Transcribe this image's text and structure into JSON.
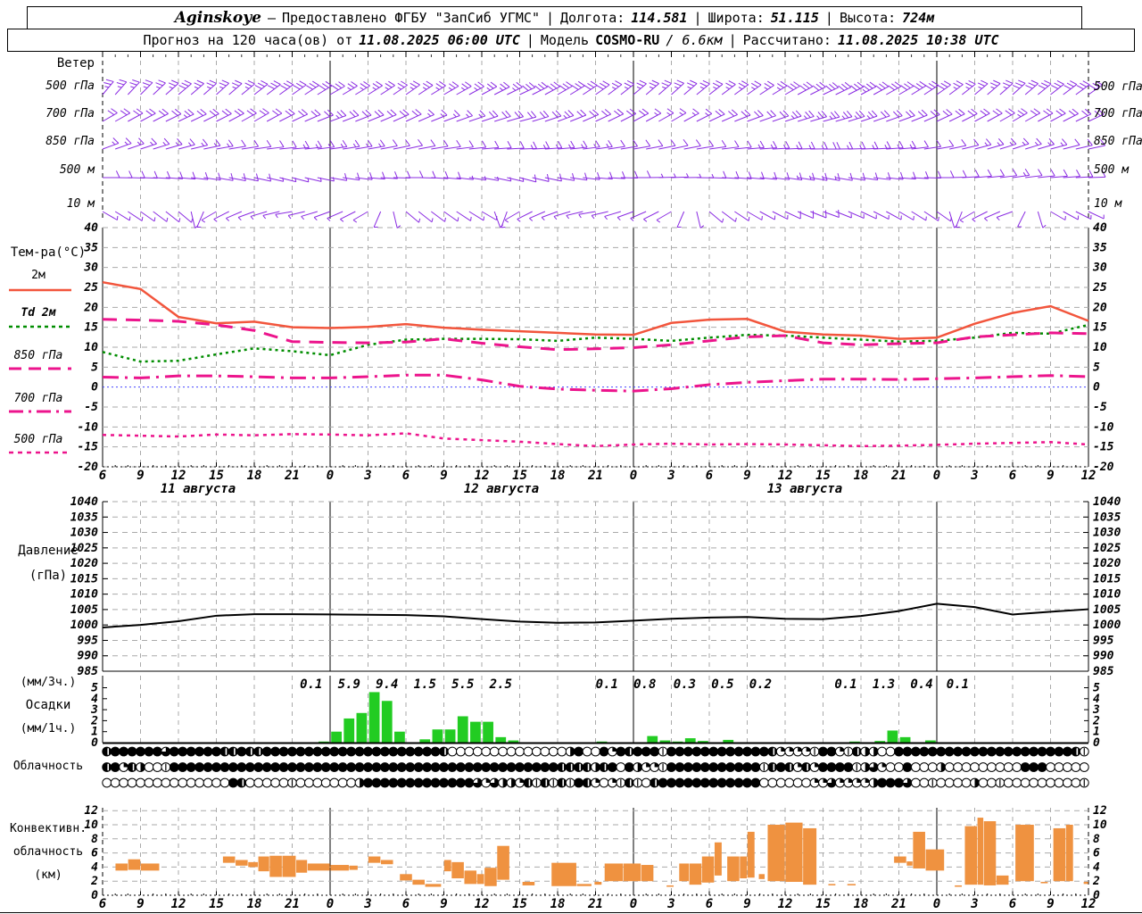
{
  "title_row1": {
    "station": "Aginskoye",
    "dash": "—",
    "provider": "Предоставлено ФГБУ \"ЗапСиб УГМС\"",
    "sep": "|",
    "lon_label": "Долгота:",
    "lon": "114.581",
    "lat_label": "Широта:",
    "lat": "51.115",
    "alt_label": "Высота:",
    "alt": "724м"
  },
  "title_row2": {
    "pre": "Прогноз на 120 часа(ов) от",
    "run": "11.08.2025 06:00 UTC",
    "sep": "|",
    "model_label": "Модель",
    "model_name": "COSMO-RU",
    "model_res": "/ 6.6км",
    "calc_label": "Рассчитано:",
    "calc": "11.08.2025 10:38 UTC"
  },
  "panel_labels": {
    "wind": "Ветер",
    "temp": "Тем-ра(°C)",
    "pressure1": "Давление",
    "pressure2": "(гПа)",
    "precip1": "(мм/3ч.)",
    "precip2": "Осадки",
    "precip3": "(мм/1ч.)",
    "cloud": "Облачность",
    "conv1": "Конвективн.",
    "conv2": "облачность",
    "conv3": "(км)"
  },
  "wind_levels": [
    "500 гПа",
    "700 гПа",
    "850 гПа",
    "500 м",
    "10 м"
  ],
  "temp_legend": [
    {
      "label": "2м",
      "color": "#f2553c",
      "dash": "",
      "width": 2.5
    },
    {
      "label": "Td  2м",
      "color": "#008d00",
      "dash": "4,4",
      "width": 2.5
    },
    {
      "label": "850 гПа",
      "color": "#ec148c",
      "dash": "14,8",
      "width": 3
    },
    {
      "label": "700 гПа",
      "color": "#ec148c",
      "dash": "16,6,3,6",
      "width": 3
    },
    {
      "label": "500 гПа",
      "color": "#ec148c",
      "dash": "5,5",
      "width": 2.5
    }
  ],
  "time_axis": {
    "labels": [
      "6",
      "9",
      "12",
      "15",
      "18",
      "21",
      "0",
      "3",
      "6",
      "9",
      "12",
      "15",
      "18",
      "21",
      "0",
      "3",
      "6",
      "9",
      "12",
      "15",
      "18",
      "21",
      "0",
      "3",
      "6",
      "9",
      "12"
    ],
    "dates": [
      {
        "label": "11 августа",
        "tick": 2
      },
      {
        "label": "12 августа",
        "tick": 10
      },
      {
        "label": "13 августа",
        "tick": 18
      }
    ]
  },
  "colors": {
    "red": "#f2553c",
    "green": "#008d00",
    "magenta": "#ec148c",
    "purple": "#8a2be2",
    "orange": "#ef9240",
    "precip_green": "#22cc22",
    "grid": "#aaaaaa",
    "zero_blue": "#4444ff",
    "black": "#000000"
  },
  "chart_data": [
    {
      "type": "line",
      "name": "temperature",
      "title": "Тем-ра(°C)",
      "x_start_hour": 0,
      "x_step_hours": 3,
      "x_end_hour": 78,
      "ylim": [
        -20,
        40
      ],
      "ytick_step": 5,
      "grid": true,
      "series": [
        {
          "name": "2м",
          "color": "#f2553c",
          "dash": "",
          "width": 2.5,
          "values": [
            26.3,
            24.6,
            17.6,
            16.0,
            16.4,
            15.0,
            14.8,
            15.1,
            15.8,
            14.9,
            14.4,
            14.0,
            13.6,
            13.2,
            13.1,
            16.1,
            16.9,
            17.1,
            13.9,
            13.2,
            12.9,
            12.1,
            12.4,
            15.9,
            18.6,
            20.3,
            16.6
          ]
        },
        {
          "name": "Td 2м",
          "color": "#008d00",
          "dash": "3,4",
          "width": 2.5,
          "values": [
            8.8,
            6.4,
            6.6,
            8.2,
            9.7,
            9.0,
            8.0,
            10.6,
            11.9,
            12.1,
            12.1,
            12.0,
            11.6,
            12.4,
            12.1,
            11.6,
            12.4,
            13.1,
            12.9,
            12.4,
            11.9,
            11.4,
            11.6,
            12.4,
            13.6,
            13.4,
            15.6
          ]
        },
        {
          "name": "850 гПа",
          "color": "#ec148c",
          "dash": "16,10",
          "width": 3,
          "values": [
            17.0,
            16.8,
            16.5,
            15.6,
            14.2,
            11.4,
            11.2,
            11.1,
            11.3,
            12.1,
            11.0,
            10.1,
            9.4,
            9.6,
            9.9,
            10.6,
            11.6,
            12.6,
            12.9,
            11.1,
            10.6,
            10.9,
            11.1,
            12.6,
            13.1,
            13.6,
            13.4
          ]
        },
        {
          "name": "700 гПа",
          "color": "#ec148c",
          "dash": "18,7,3,7",
          "width": 3,
          "values": [
            2.5,
            2.3,
            2.8,
            2.8,
            2.6,
            2.3,
            2.3,
            2.6,
            3.0,
            3.0,
            1.8,
            0.2,
            -0.5,
            -0.8,
            -1.0,
            -0.4,
            0.6,
            1.2,
            1.6,
            2.0,
            2.0,
            1.9,
            2.1,
            2.3,
            2.6,
            2.9,
            2.6
          ]
        },
        {
          "name": "500 гПа",
          "color": "#ec148c",
          "dash": "4,5",
          "width": 2.5,
          "values": [
            -12.0,
            -12.2,
            -12.4,
            -11.9,
            -12.1,
            -11.8,
            -11.9,
            -12.1,
            -11.6,
            -12.9,
            -13.3,
            -13.7,
            -14.3,
            -14.8,
            -14.4,
            -14.2,
            -14.4,
            -14.3,
            -14.4,
            -14.6,
            -14.8,
            -14.7,
            -14.5,
            -14.2,
            -14.0,
            -13.8,
            -14.4
          ]
        }
      ],
      "zero_line_value": 0
    },
    {
      "type": "line",
      "name": "pressure",
      "title": "Давление (гПа)",
      "ylim": [
        985,
        1040
      ],
      "ytick_step": 5,
      "color": "#000000",
      "values": [
        999.2,
        1000.0,
        1001.2,
        1003.0,
        1003.5,
        1003.5,
        1003.4,
        1003.3,
        1003.2,
        1002.8,
        1001.9,
        1001.1,
        1000.7,
        1000.8,
        1001.4,
        1002.0,
        1002.4,
        1002.6,
        1002.0,
        1001.9,
        1002.9,
        1004.5,
        1006.9,
        1005.8,
        1003.4,
        1004.3,
        1005.1
      ]
    },
    {
      "type": "bar",
      "name": "precipitation",
      "title": "Осадки (мм/1ч.)",
      "ylim": [
        0,
        6
      ],
      "yticks": [
        0,
        1,
        2,
        3,
        4,
        5
      ],
      "color": "#22cc22",
      "bars_hourly": [
        [
          17,
          0.1
        ],
        [
          18,
          1.0
        ],
        [
          19,
          2.2
        ],
        [
          20,
          2.7
        ],
        [
          21,
          4.6
        ],
        [
          22,
          3.8
        ],
        [
          23,
          1.0
        ],
        [
          25,
          0.3
        ],
        [
          26,
          1.2
        ],
        [
          27,
          1.2
        ],
        [
          28,
          2.4
        ],
        [
          29,
          1.9
        ],
        [
          30,
          1.9
        ],
        [
          31,
          0.5
        ],
        [
          32,
          0.2
        ],
        [
          39,
          0.1
        ],
        [
          43,
          0.6
        ],
        [
          44,
          0.2
        ],
        [
          45,
          0.1
        ],
        [
          46,
          0.4
        ],
        [
          47,
          0.15
        ],
        [
          49,
          0.25
        ],
        [
          59,
          0.1
        ],
        [
          61,
          0.15
        ],
        [
          62,
          1.1
        ],
        [
          63,
          0.5
        ],
        [
          65,
          0.2
        ]
      ],
      "sum_labels_3h": [
        [
          5.5,
          "0.1"
        ],
        [
          6.5,
          "5.9"
        ],
        [
          7.5,
          "9.4"
        ],
        [
          8.5,
          "1.5"
        ],
        [
          9.5,
          "5.5"
        ],
        [
          10.5,
          "2.5"
        ],
        [
          13.3,
          "0.1"
        ],
        [
          14.3,
          "0.8"
        ],
        [
          15.35,
          "0.3"
        ],
        [
          16.35,
          "0.5"
        ],
        [
          17.35,
          "0.2"
        ],
        [
          19.6,
          "0.1"
        ],
        [
          20.6,
          "1.3"
        ],
        [
          21.6,
          "0.4"
        ],
        [
          22.55,
          "0.1"
        ]
      ]
    },
    {
      "type": "range-bar",
      "name": "convective-cloud",
      "title": "Конвективная облачность (км)",
      "ylim": [
        0,
        13
      ],
      "yticks": [
        0,
        2,
        4,
        6,
        8,
        10,
        12
      ],
      "color": "#ef9240",
      "bars": [
        [
          1,
          2,
          3.5,
          4.5
        ],
        [
          2,
          3,
          3.6,
          5.1
        ],
        [
          3,
          4.5,
          3.5,
          4.5
        ],
        [
          9.5,
          10.5,
          4.6,
          5.5
        ],
        [
          10.5,
          11.5,
          4.2,
          5.0
        ],
        [
          11.5,
          12.3,
          4.0,
          4.7
        ],
        [
          12.3,
          13.2,
          3.4,
          5.5
        ],
        [
          13.2,
          14.2,
          2.6,
          5.6
        ],
        [
          14.2,
          15.3,
          2.6,
          5.6
        ],
        [
          15.3,
          16.2,
          3.2,
          5.0
        ],
        [
          16.2,
          18,
          3.5,
          4.5
        ],
        [
          18,
          19.5,
          3.5,
          4.3
        ],
        [
          19.5,
          20.2,
          3.6,
          4.2
        ],
        [
          21,
          22,
          4.6,
          5.5
        ],
        [
          22,
          23,
          4.4,
          5.0
        ],
        [
          23.5,
          24.5,
          2.1,
          3.0
        ],
        [
          24.5,
          25.5,
          1.5,
          2.2
        ],
        [
          25.5,
          26.8,
          1.2,
          1.6
        ],
        [
          27,
          27.6,
          3.4,
          5.0
        ],
        [
          27.6,
          28.6,
          2.4,
          4.7
        ],
        [
          28.6,
          29.6,
          1.6,
          3.5
        ],
        [
          29.6,
          30.2,
          1.6,
          3.0
        ],
        [
          30.2,
          31.2,
          1.3,
          3.9
        ],
        [
          31.2,
          32.2,
          2.2,
          7.0
        ],
        [
          33.2,
          34.2,
          1.4,
          1.9
        ],
        [
          35.5,
          37.5,
          1.3,
          4.6
        ],
        [
          37.5,
          38.7,
          1.3,
          1.6
        ],
        [
          38.9,
          39.5,
          1.5,
          1.9
        ],
        [
          39.7,
          41.2,
          2.0,
          4.5
        ],
        [
          41.2,
          42.6,
          2.0,
          4.5
        ],
        [
          42.6,
          43.6,
          2.0,
          4.3
        ],
        [
          44.6,
          45.2,
          1.2,
          1.4
        ],
        [
          45.6,
          46.4,
          2.0,
          4.5
        ],
        [
          46.4,
          47.4,
          1.5,
          4.5
        ],
        [
          47.4,
          48.4,
          1.8,
          5.5
        ],
        [
          48.4,
          49.0,
          2.8,
          7.5
        ],
        [
          49.4,
          50.4,
          2.0,
          5.5
        ],
        [
          50.4,
          51.0,
          2.4,
          5.5
        ],
        [
          51.0,
          51.6,
          2.5,
          9.0
        ],
        [
          51.9,
          52.4,
          2.3,
          3.0
        ],
        [
          52.6,
          54.0,
          2.0,
          10.0
        ],
        [
          54.0,
          55.4,
          1.9,
          10.3
        ],
        [
          55.4,
          56.5,
          1.5,
          9.5
        ],
        [
          57.4,
          58.0,
          1.4,
          1.6
        ],
        [
          58.9,
          59.6,
          1.4,
          1.6
        ],
        [
          62.6,
          63.6,
          4.6,
          5.5
        ],
        [
          63.6,
          64.1,
          4.2,
          4.8
        ],
        [
          64.1,
          65.1,
          3.8,
          9.0
        ],
        [
          65.1,
          66.6,
          3.5,
          6.5
        ],
        [
          67.4,
          68.0,
          1.2,
          1.4
        ],
        [
          68.2,
          69.2,
          1.5,
          9.8
        ],
        [
          69.2,
          69.7,
          1.5,
          11.0
        ],
        [
          69.7,
          70.7,
          1.4,
          10.5
        ],
        [
          70.7,
          71.7,
          1.5,
          2.8
        ],
        [
          72.2,
          73.7,
          2.0,
          10.0
        ],
        [
          74.2,
          74.8,
          1.7,
          1.9
        ],
        [
          75.2,
          76.2,
          2.0,
          9.5
        ],
        [
          76.2,
          76.8,
          2.0,
          10.0
        ],
        [
          77.6,
          78.0,
          1.6,
          1.9
        ]
      ]
    }
  ],
  "cloud_cover": {
    "rows": [
      "788888868888887787788888888888888888888870000000000000048008287888188888888888872222188217440088888888888888888888871",
      "782740018888888888888888888888888888888888888888888888777747808422188888888888178727288881462008000400000000088800000",
      "000000000000000870000010000000488888888888886264427171718720217107888888888888000000226222248886001000040010000000001"
    ]
  },
  "wind_barbs": {
    "color": "#8a2be2",
    "rows": [
      {
        "level": "500 гПа",
        "dirs": [
          320,
          315,
          310,
          312,
          308,
          305,
          300,
          302,
          305,
          300,
          298,
          295,
          300,
          305,
          310,
          312,
          308,
          305,
          300,
          295,
          298,
          300,
          305,
          310,
          312,
          308,
          305
        ],
        "speeds": [
          25,
          25,
          30,
          28,
          30,
          32,
          30,
          28,
          25,
          25,
          28,
          30,
          32,
          30,
          28,
          25,
          25,
          28,
          30,
          32,
          35,
          32,
          30,
          28,
          30,
          32,
          30
        ]
      },
      {
        "level": "700 гПа",
        "dirs": [
          300,
          298,
          295,
          297,
          300,
          295,
          290,
          292,
          295,
          290,
          288,
          285,
          290,
          295,
          298,
          300,
          295,
          290,
          288,
          285,
          288,
          290,
          295,
          298,
          300,
          298,
          295
        ],
        "speeds": [
          20,
          22,
          25,
          22,
          20,
          22,
          25,
          22,
          20,
          18,
          20,
          22,
          25,
          22,
          20,
          18,
          20,
          22,
          25,
          28,
          25,
          22,
          20,
          22,
          25,
          22,
          20
        ]
      },
      {
        "level": "850 гПа",
        "dirs": [
          290,
          288,
          285,
          280,
          278,
          275,
          278,
          280,
          282,
          278,
          275,
          272,
          275,
          278,
          280,
          282,
          278,
          275,
          272,
          270,
          272,
          275,
          280,
          285,
          288,
          285,
          282
        ],
        "speeds": [
          15,
          15,
          18,
          15,
          12,
          15,
          18,
          15,
          12,
          10,
          12,
          15,
          18,
          15,
          12,
          10,
          12,
          15,
          18,
          20,
          18,
          15,
          12,
          15,
          18,
          15,
          10
        ]
      },
      {
        "level": "500 м",
        "dirs": [
          270,
          268,
          265,
          260,
          258,
          255,
          260,
          265,
          270,
          265,
          260,
          255,
          260,
          265,
          270,
          272,
          268,
          265,
          262,
          260,
          262,
          265,
          270,
          275,
          278,
          275,
          272
        ],
        "speeds": [
          10,
          10,
          12,
          12,
          10,
          8,
          10,
          12,
          12,
          10,
          8,
          10,
          12,
          12,
          10,
          8,
          10,
          12,
          15,
          15,
          12,
          10,
          10,
          12,
          15,
          12,
          10
        ]
      },
      {
        "level": "10 м",
        "dirs": [
          240,
          235,
          230,
          120,
          110,
          100,
          110,
          120,
          230,
          235,
          240,
          120,
          110,
          100,
          110,
          120,
          230,
          240,
          245,
          250,
          245,
          240,
          235,
          120,
          110,
          240,
          245
        ],
        "speeds": [
          8,
          8,
          8,
          5,
          5,
          5,
          5,
          5,
          8,
          8,
          8,
          5,
          5,
          5,
          5,
          5,
          8,
          8,
          10,
          10,
          8,
          8,
          8,
          5,
          5,
          8,
          8
        ]
      }
    ]
  }
}
